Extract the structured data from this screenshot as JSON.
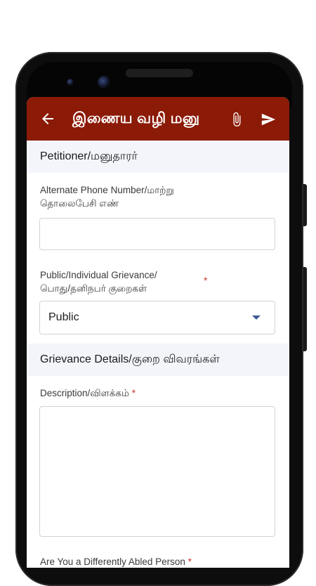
{
  "app_bar": {
    "title": "இணைய வழி மனு",
    "back_icon": "arrow-left-icon",
    "attach_icon": "paperclip-icon",
    "send_icon": "send-icon",
    "color": "#8b1a06"
  },
  "sections": {
    "petitioner": "Petitioner/மனுதாரர்",
    "grievance_details": "Grievance Details/குறை விவரங்கள்"
  },
  "fields": {
    "alt_phone": {
      "label_line1": "Alternate Phone Number/மாற்று",
      "label_line2": "தொலைபேசி எண்",
      "value": ""
    },
    "grievance_type": {
      "label_line1": "Public/Individual Grievance/",
      "label_line2": "பொது/தனிநபர் குறைகள்",
      "required_mark": "*",
      "selected": "Public"
    },
    "description": {
      "label": "Description/விளக்கம்",
      "required_mark": "*",
      "value": ""
    },
    "differently_abled": {
      "label": "Are You a Differently Abled Person",
      "required_mark": "*"
    }
  }
}
